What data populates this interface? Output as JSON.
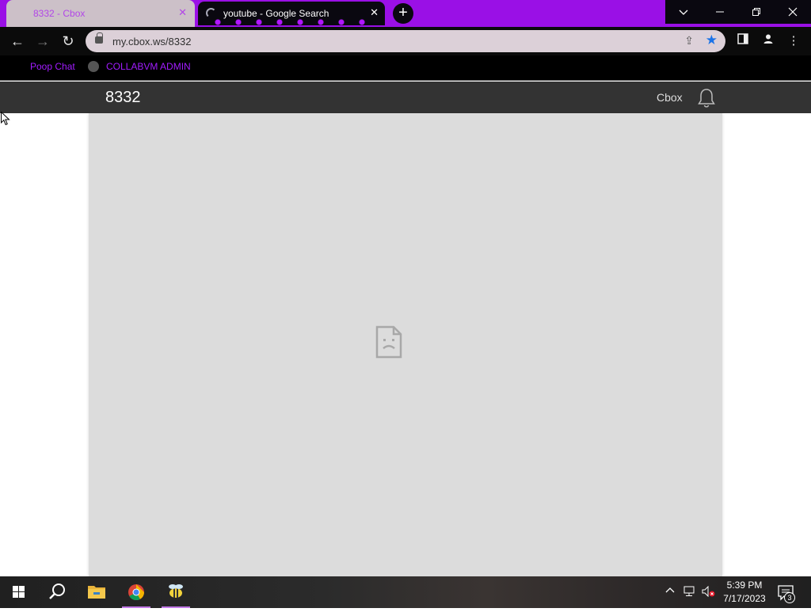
{
  "browser": {
    "tabs": [
      {
        "title": "8332 - Cbox",
        "active": true
      },
      {
        "title": "youtube - Google Search",
        "active": false,
        "loading": true
      }
    ],
    "new_tab_icon": "plus-icon",
    "window_controls": [
      "tab-search-chevron-icon",
      "minimize-icon",
      "restore-icon",
      "close-icon"
    ],
    "address_bar": {
      "url": "my.cbox.ws/8332",
      "bookmarked": true
    },
    "bookmarks": [
      {
        "label": "Poop Chat"
      },
      {
        "label": "COLLABVM ADMIN"
      }
    ],
    "accent_color": "#9a10e6"
  },
  "page": {
    "title": "8332",
    "brand_link": "Cbox",
    "frame_state": "sad-page-icon"
  },
  "taskbar": {
    "pinned": [
      "windows-start-icon",
      "search-icon",
      "file-explorer-icon",
      "chrome-icon",
      "bee-app-icon"
    ],
    "clock_time": "5:39 PM",
    "clock_date": "7/17/2023",
    "notification_count": "3"
  }
}
